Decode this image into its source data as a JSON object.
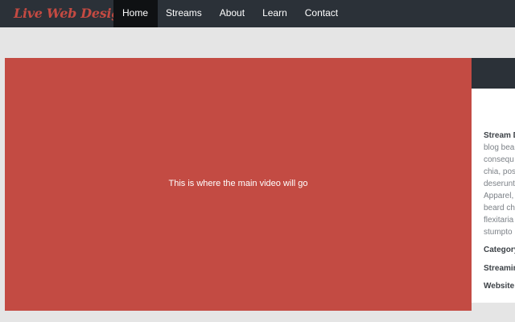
{
  "brand": "Live Web Design",
  "nav": {
    "items": [
      {
        "label": "Home"
      },
      {
        "label": "Streams"
      },
      {
        "label": "About"
      },
      {
        "label": "Learn"
      },
      {
        "label": "Contact"
      }
    ]
  },
  "video": {
    "placeholder": "This is where the main video will go"
  },
  "sidebar": {
    "description_label": "Stream D",
    "description_lines": [
      "blog bea",
      "consequ",
      "chia, pos",
      "deserunt",
      "Apparel,",
      "beard ch",
      "flexitaria",
      "stumpto"
    ],
    "category_label": "Category",
    "streaming_label": "Streamir",
    "website_label": "Website"
  },
  "colors": {
    "navbar": "#2b3138",
    "active_nav": "#0f1113",
    "brand": "#c44a42",
    "video": "#c34b43",
    "background": "#e5e5e5"
  }
}
